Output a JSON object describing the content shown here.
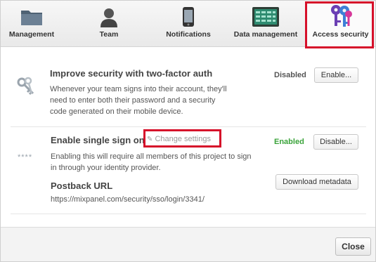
{
  "tabs": [
    {
      "label": "Management",
      "icon": "folder-icon"
    },
    {
      "label": "Team",
      "icon": "person-icon"
    },
    {
      "label": "Notifications",
      "icon": "phone-icon"
    },
    {
      "label": "Data management",
      "icon": "data-board-icon"
    },
    {
      "label": "Access security",
      "icon": "keys-icon",
      "active": true
    }
  ],
  "two_factor": {
    "title": "Improve security with two-factor auth",
    "description": "Whenever your team signs into their account, they'll need to enter both their password and a security code generated on their mobile device.",
    "status": "Disabled",
    "button": "Enable..."
  },
  "sso": {
    "title": "Enable single sign on",
    "change_settings": "Change settings",
    "description": "Enabling this will require all members of this project to sign in through your identity provider.",
    "status": "Enabled",
    "button": "Disable...",
    "icon_text": "****",
    "postback_title": "Postback URL",
    "postback_url": "https://mixpanel.com/security/sso/login/3341/",
    "download_button": "Download metadata"
  },
  "footer": {
    "close_button": "Close"
  },
  "colors": {
    "enabled_green": "#3aa33a",
    "disabled_gray": "#555555",
    "highlight_red": "#d6102a"
  }
}
